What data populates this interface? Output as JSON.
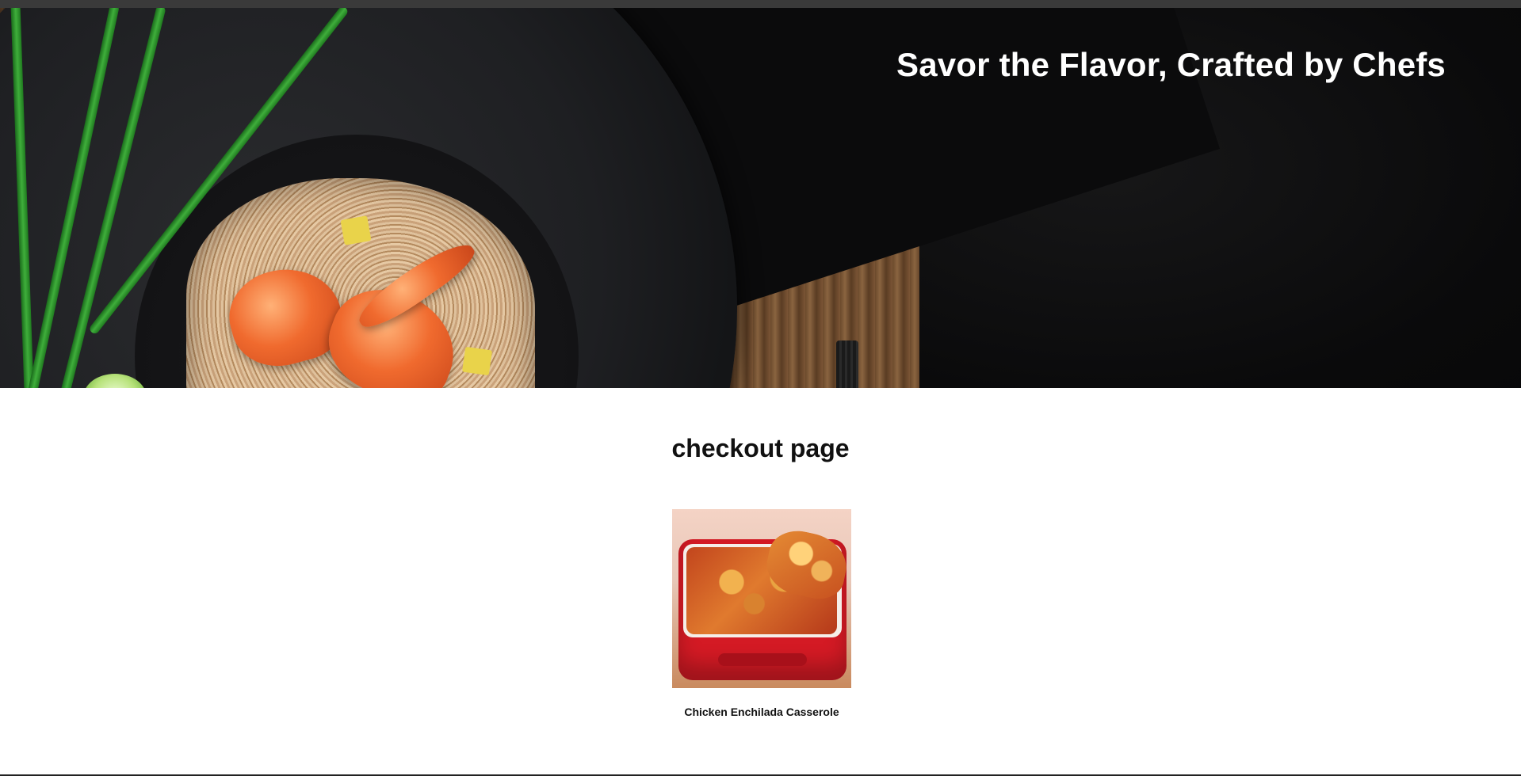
{
  "hero": {
    "title": "Savor the Flavor, Crafted by Chefs"
  },
  "checkout": {
    "heading": "checkout page",
    "items": [
      {
        "name": "Chicken Enchilada Casserole"
      }
    ]
  }
}
